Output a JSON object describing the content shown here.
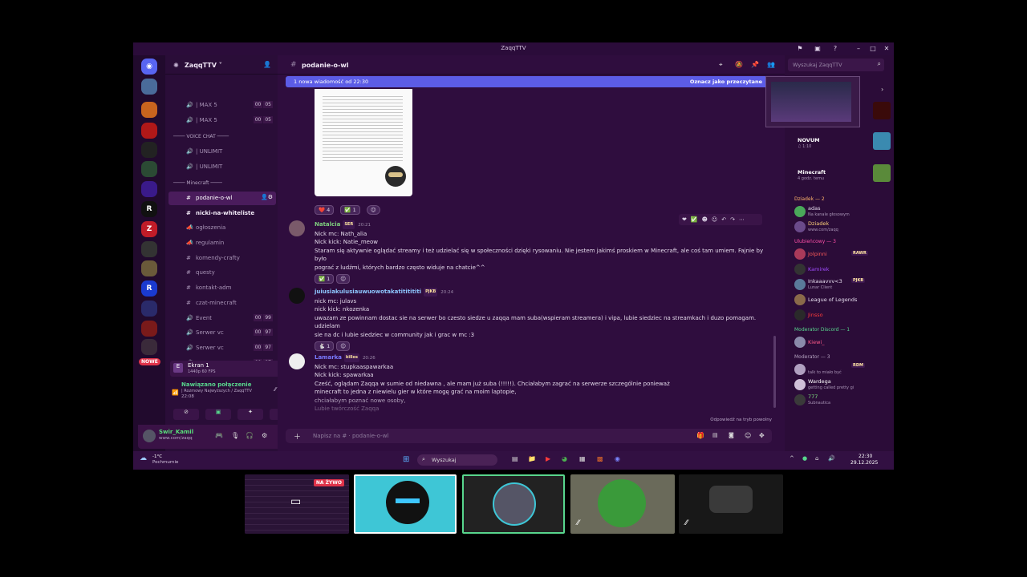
{
  "window": {
    "title": "ZaqqTTV"
  },
  "servers": {
    "nowe_badge": "NOWE"
  },
  "guild": {
    "name": "ZaqqTTV ˅"
  },
  "channels": [
    {
      "icon": "🔊",
      "name": "| MAX 5",
      "c1": "00",
      "c2": "05"
    },
    {
      "icon": "🔊",
      "name": "| MAX 5",
      "c1": "00",
      "c2": "05"
    },
    {
      "cat": "VOICE CHAT"
    },
    {
      "icon": "🔊",
      "name": "| UNLIMIT"
    },
    {
      "icon": "🔊",
      "name": "| UNLIMIT"
    },
    {
      "cat": "Minecraft"
    },
    {
      "icon": "#",
      "name": "podanie-o-wl",
      "active": true
    },
    {
      "icon": "#",
      "name": "nicki-na-whiteliste",
      "bold": true
    },
    {
      "icon": "📣",
      "name": "ogłoszenia"
    },
    {
      "icon": "📣",
      "name": "regulamin"
    },
    {
      "icon": "#",
      "name": "komendy-crafty"
    },
    {
      "icon": "#",
      "name": "questy"
    },
    {
      "icon": "#",
      "name": "kontakt-adm"
    },
    {
      "icon": "#",
      "name": "czat-minecraft"
    },
    {
      "icon": "🔊",
      "name": "Event",
      "c1": "00",
      "c2": "99"
    },
    {
      "icon": "🔊",
      "name": "Serwer vc",
      "c1": "00",
      "c2": "97"
    },
    {
      "icon": "🔊",
      "name": "Serwer vc",
      "c1": "00",
      "c2": "97"
    },
    {
      "icon": "🔊",
      "name": "Serwer vc",
      "c1": "00",
      "c2": "97"
    }
  ],
  "stream": {
    "title": "Ekran 1",
    "sub": "1440p 60 FPS"
  },
  "voice": {
    "status": "Nawiązano połączenie",
    "channel": "| Rozmowy Najwyższych / ZaqqTTV",
    "time": "22:08"
  },
  "user": {
    "name": "Swir_Kamil",
    "status": "www.com/zaqq"
  },
  "header": {
    "channel": "podanie-o-wl",
    "search_placeholder": "Wyszukaj ZaqqTTV"
  },
  "newbar": {
    "left": "1 nowa wiadomość od 22:30",
    "right": "Oznacz jako przeczytane"
  },
  "reactions_top": [
    {
      "emoji": "❤️",
      "count": "4"
    },
    {
      "emoji": "✅",
      "count": "1"
    }
  ],
  "messages": [
    {
      "name": "Natalcia",
      "tag": "SER",
      "time": "20:21",
      "color": "#7fd07f",
      "lines": [
        "Nick mc: Nath_alia",
        "Nick kick: Natie_meow",
        "Staram się aktywnie oglądać streamy i też udzielać się w społeczności dzięki rysowaniu. Nie jestem jakimś proskiem w Minecraft, ale coś tam umiem. Fajnie by było",
        "pograć z ludźmi, których bardzo często widuje na chatcie^^"
      ],
      "reaction": {
        "emoji": "✅",
        "count": "1"
      }
    },
    {
      "name": "juiusiakulusiauwuowotakatititititi",
      "tag": "PJKB",
      "time": "20:24",
      "color": "#8ec7ff",
      "lines": [
        "nick mc: julavs",
        "nick kick: nkozenka",
        "uwazam ze powinnam dostac sie na serwer bo czesto siedze u zaqqa mam suba(wspieram streamera) i vipa, lubie siedziec na streamkach i duzo pomagam. udzielam",
        "sie na dc i lubie siedziec w community jak i grac w mc :3"
      ],
      "reaction": {
        "emoji": "🐇",
        "count": "1"
      }
    },
    {
      "name": "Lamarka",
      "tag": "killos",
      "time": "20:26",
      "color": "#7a7aff",
      "lines": [
        "Nick mc: stupkaaspawarkaa",
        "Nick kick: spawarkaa",
        "Cześć, oglądam Zaqqa w sumie od niedawna , ale mam już suba (!!!!!). Chciałabym zagrać na serwerze szczególnie ponieważ",
        "minecraft to jedna z niewielu gier w które mogę grać na moim laptopie,",
        "chciałabym poznać nowe osoby,",
        "Lubie twórczość Zaqqa"
      ]
    }
  ],
  "composer": {
    "placeholder": "Napisz na #  ·  podanie-o-wl",
    "slowmode": "Odpowiedź na tryb powolny"
  },
  "members": {
    "activities": [
      {
        "name": "NOVUM",
        "sub": "♫ 1:10"
      },
      {
        "name": "Minecraft",
        "sub": "4 godz. temu"
      }
    ],
    "groups": [
      {
        "label": "Dziadek — 2",
        "color": "#ffb36b",
        "items": [
          {
            "name": "adas",
            "sub": "Na kanale głosowym",
            "color": "#e6ddee"
          },
          {
            "name": "Dziadek",
            "sub": "www.com/zaqq",
            "color": "#ffd27a"
          }
        ]
      },
      {
        "label": "Ulubieńcowy — 3",
        "color": "#ff4fa8",
        "items": [
          {
            "name": "Jolpinni",
            "sub": "",
            "color": "#ff5a5a",
            "badge": "RAWR"
          },
          {
            "name": "Kamirek",
            "sub": "",
            "color": "#a04cff"
          },
          {
            "name": "Inkaaavvv<3",
            "sub": "Lunar Client",
            "color": "#e6ddee",
            "badge": "PJKB"
          },
          {
            "name": "League of Legends",
            "sub": "",
            "color": "#e6ddee"
          },
          {
            "name": "Jinsso",
            "sub": "",
            "color": "#ff3b3b"
          }
        ]
      },
      {
        "label": "Moderator Discord — 1",
        "color": "#58d68d",
        "items": [
          {
            "name": "Kiewi_",
            "sub": "",
            "color": "#ff5a8a"
          }
        ]
      },
      {
        "label": "Moderator — 3",
        "color": "#b5a3c1",
        "items": [
          {
            "name": "",
            "sub": "talk to miało być",
            "color": "#e6ddee",
            "badge": "RDM"
          },
          {
            "name": "Wardega",
            "sub": "getting called pretty gi",
            "color": "#fff"
          },
          {
            "name": "777",
            "sub": "Subnautica",
            "color": "#7fe07f"
          }
        ]
      }
    ]
  },
  "taskbar": {
    "weather_temp": "-1°C",
    "weather_desc": "Pochmurnie",
    "search": "Wyszukaj",
    "time": "22:30",
    "date": "29.12.2025"
  },
  "live_badge": "NA ŻYWO"
}
